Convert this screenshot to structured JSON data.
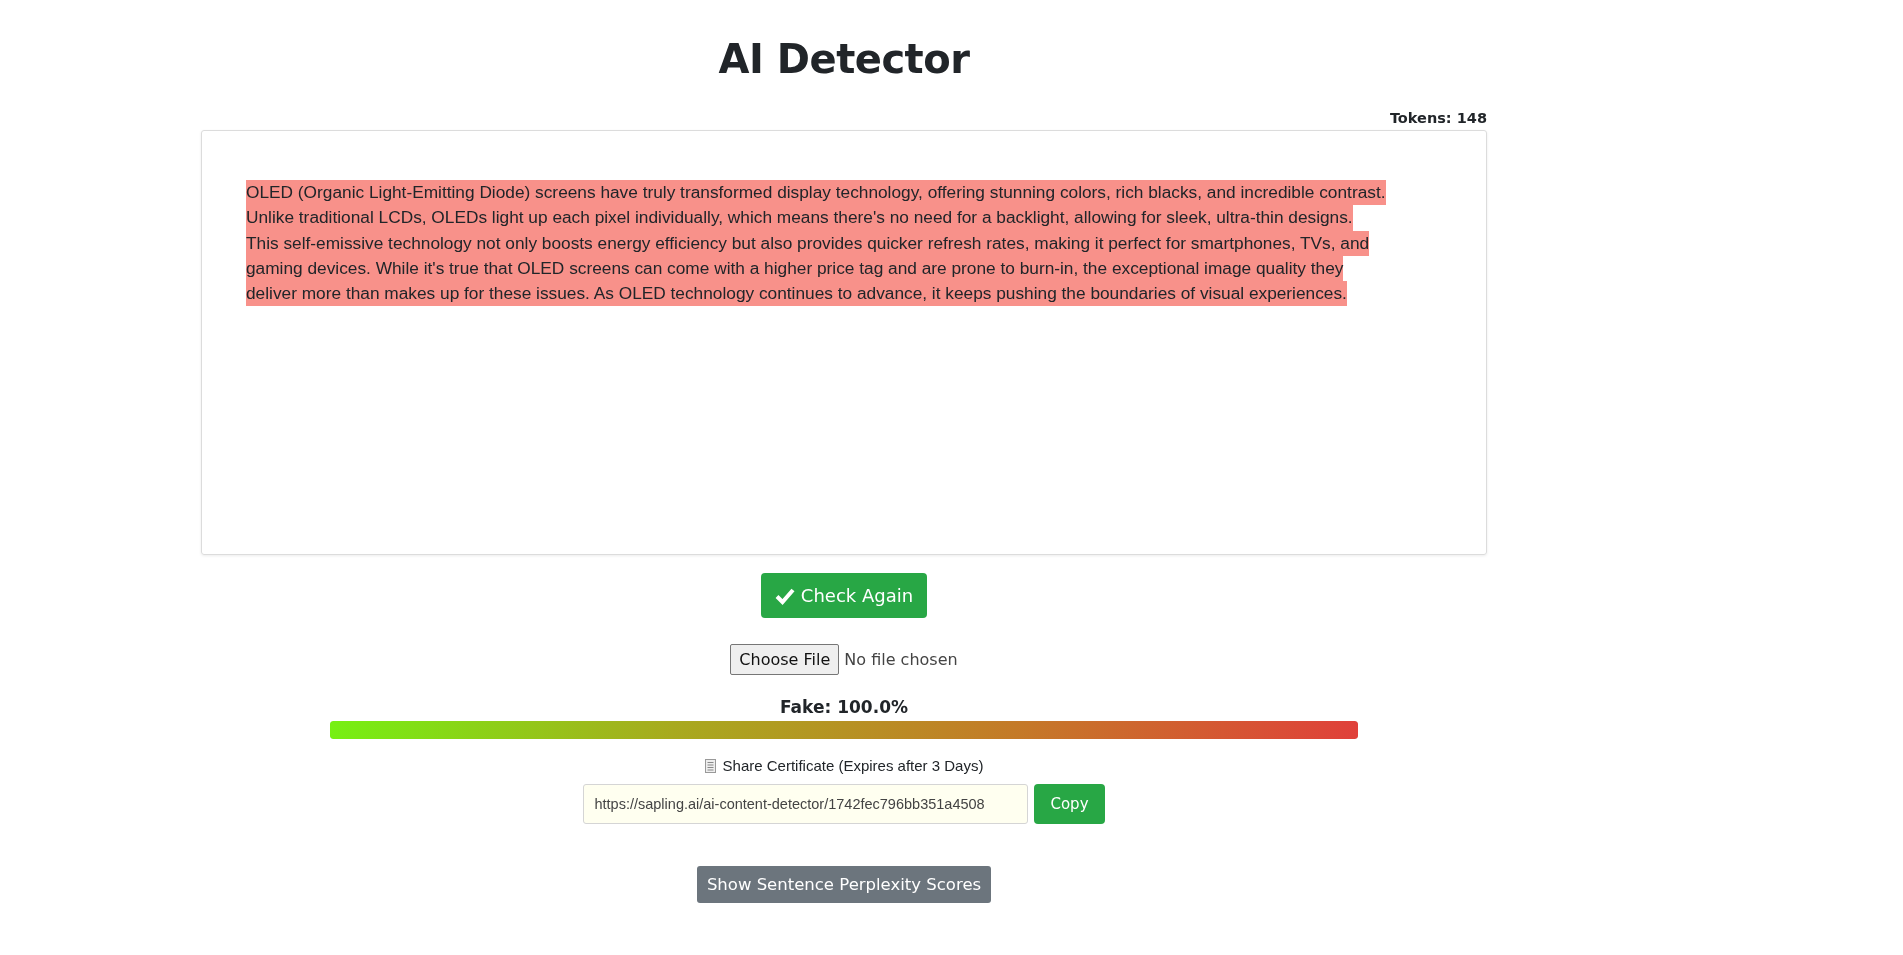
{
  "title": "AI Detector",
  "tokens": "Tokens: 148",
  "passage": {
    "highlighted": true,
    "lines": [
      "OLED (Organic Light-Emitting Diode) screens have truly transformed display technology, offering stunning colors, rich blacks, and incredible contrast.",
      "Unlike traditional LCDs, OLEDs light up each pixel individually, which means there's no need for a backlight, allowing for sleek, ultra-thin designs.",
      "This self-emissive technology not only boosts energy efficiency but also provides quicker refresh rates, making it perfect for smartphones, TVs, and",
      "gaming devices. While it's true that OLED screens can come with a higher price tag and are prone to burn-in, the exceptional image quality they",
      "deliver more than makes up for these issues. As OLED technology continues to advance, it keeps pushing the boundaries of visual experiences."
    ]
  },
  "check_button": "Check Again",
  "file_input": {
    "button": "Choose File",
    "status": "No file chosen"
  },
  "score": {
    "label": "Fake: 100.0%",
    "level": 1.0
  },
  "share": {
    "label": "Share Certificate (Expires after 3 Days)",
    "url": "https://sapling.ai/ai-content-detector/1742fec796bb351a4508",
    "copy_button": "Copy"
  },
  "perplexity_button": "Show Sentence Perplexity Scores"
}
